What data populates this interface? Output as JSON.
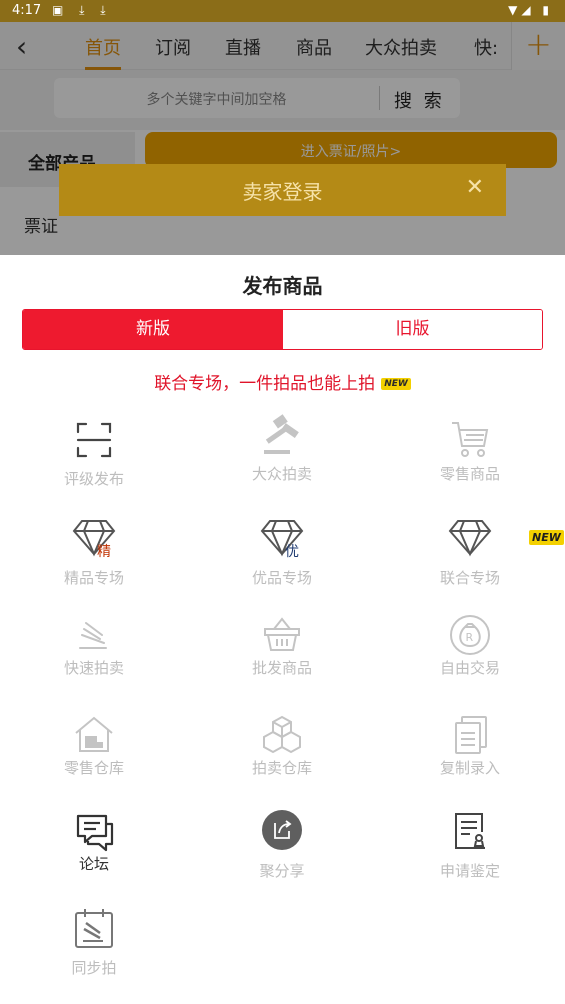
{
  "status_bar": {
    "time": "4:17",
    "left_icons": "▣ ⤓ ⤓",
    "right_icons": "▼◢ ▮"
  },
  "nav": {
    "tabs": [
      "首页",
      "订阅",
      "直播",
      "商品",
      "大众拍卖",
      "快:"
    ],
    "active_tab": "首页"
  },
  "search": {
    "placeholder": "多个关键字中间加空格",
    "button": "搜 索"
  },
  "background": {
    "sidebar_all": "全部产品",
    "sidebar_ticket": "票证",
    "enter_banner": "进入票证/照片>"
  },
  "seller_dialog": {
    "title": "卖家登录",
    "close": "✕"
  },
  "sheet": {
    "title": "发布商品",
    "tab_new": "新版",
    "tab_old": "旧版",
    "promo": "联合专场，一件拍品也能上拍",
    "promo_tag": "NEW",
    "corner_tag": "NEW",
    "items": [
      {
        "label": "评级发布",
        "icon": "scan-icon"
      },
      {
        "label": "大众拍卖",
        "icon": "gavel-icon"
      },
      {
        "label": "零售商品",
        "icon": "cart-icon"
      },
      {
        "label": "精品专场",
        "icon": "diamond-icon",
        "badge": "精"
      },
      {
        "label": "优品专场",
        "icon": "diamond-icon",
        "badge": "优"
      },
      {
        "label": "联合专场",
        "icon": "diamond-icon"
      },
      {
        "label": "快速拍卖",
        "icon": "quick-gavel-icon"
      },
      {
        "label": "批发商品",
        "icon": "basket-icon"
      },
      {
        "label": "自由交易",
        "icon": "money-bag-icon",
        "badge": "R"
      },
      {
        "label": "零售仓库",
        "icon": "warehouse-icon"
      },
      {
        "label": "拍卖仓库",
        "icon": "boxes-icon"
      },
      {
        "label": "复制录入",
        "icon": "copy-doc-icon"
      },
      {
        "label": "论坛",
        "icon": "forum-chat-icon"
      },
      {
        "label": "聚分享",
        "icon": "share-icon"
      },
      {
        "label": "申请鉴定",
        "icon": "appraisal-doc-icon"
      },
      {
        "label": "同步拍",
        "icon": "sync-auction-icon"
      }
    ]
  }
}
